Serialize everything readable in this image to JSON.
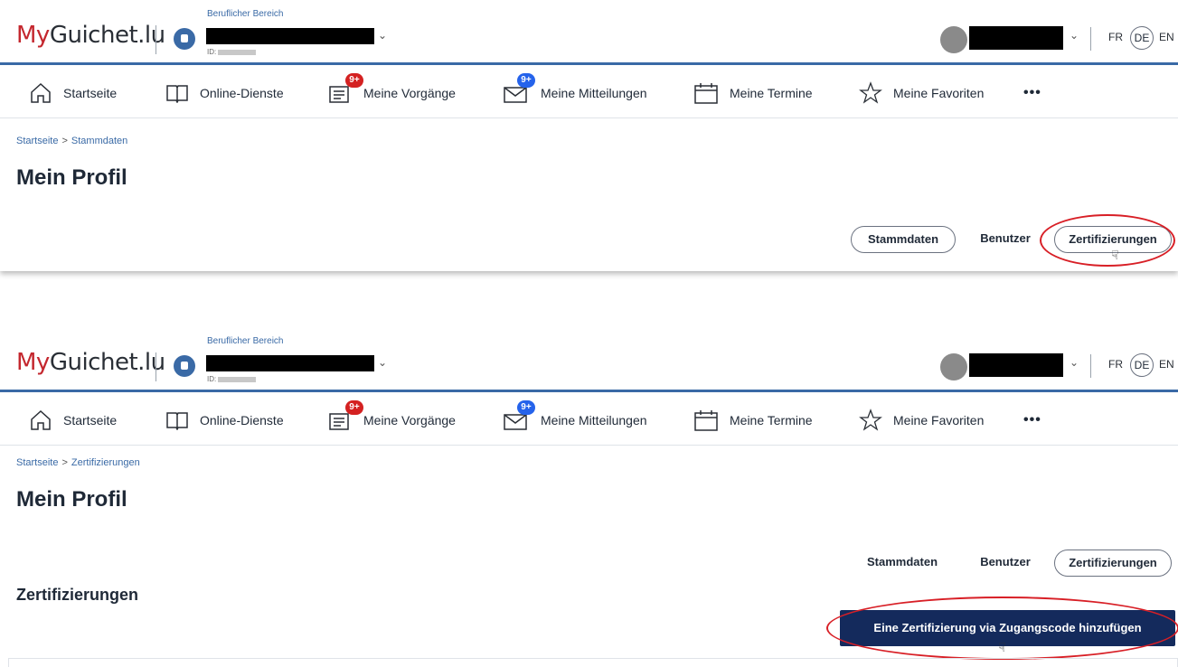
{
  "header": {
    "logo_prefix": "My",
    "logo_suffix": "Guichet.lu",
    "org_label": "Beruflicher Bereich",
    "org_id_prefix": "ID:",
    "languages": [
      "FR",
      "DE",
      "EN"
    ],
    "active_language": "DE"
  },
  "nav": {
    "items": [
      {
        "label": "Startseite",
        "icon": "home-icon"
      },
      {
        "label": "Online-Dienste",
        "icon": "book-icon"
      },
      {
        "label": "Meine Vorgänge",
        "icon": "document-icon",
        "badge": "9+",
        "badge_color": "#d42121"
      },
      {
        "label": "Meine Mitteilungen",
        "icon": "mail-icon",
        "badge": "9+",
        "badge_color": "#2563eb"
      },
      {
        "label": "Meine Termine",
        "icon": "calendar-icon"
      },
      {
        "label": "Meine Favoriten",
        "icon": "star-icon"
      }
    ],
    "more": "•••"
  },
  "panel1": {
    "breadcrumb": [
      "Startseite",
      "Stammdaten"
    ],
    "title": "Mein Profil",
    "tabs": [
      "Stammdaten",
      "Benutzer",
      "Zertifizierungen"
    ]
  },
  "panel2": {
    "breadcrumb": [
      "Startseite",
      "Zertifizierungen"
    ],
    "title": "Mein Profil",
    "tabs": [
      "Stammdaten",
      "Benutzer",
      "Zertifizierungen"
    ],
    "section_title": "Zertifizierungen",
    "add_button": "Eine Zertifizierung via Zugangscode hinzufügen"
  },
  "colors": {
    "brand_red": "#c4272e",
    "header_blue": "#3a6aa6",
    "primary_button": "#142a5c",
    "highlight_ring": "#d81f26"
  }
}
